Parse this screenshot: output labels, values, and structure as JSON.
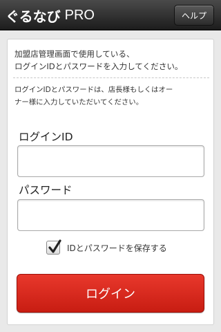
{
  "header": {
    "brand": "ぐるなび",
    "product": "PRO",
    "help_label": "ヘルプ"
  },
  "form": {
    "intro_line1": "加盟店管理画面で使用している、",
    "intro_line2": "ログインIDとパスワードを入力してください。",
    "note_line1": "ログインIDとパスワードは、店長様もしくはオー",
    "note_line2": "ナー様に入力していただいてください。",
    "login_id_label": "ログインID",
    "login_id_value": "",
    "password_label": "パスワード",
    "password_value": "",
    "save_checked": true,
    "save_label": "IDとパスワードを保存する",
    "login_button_label": "ログイン"
  },
  "colors": {
    "header_bg": "#2a2a2a",
    "page_bg": "#e9e9e9",
    "login_button": "#d8281d"
  },
  "icons": [
    "checkmark-icon"
  ]
}
